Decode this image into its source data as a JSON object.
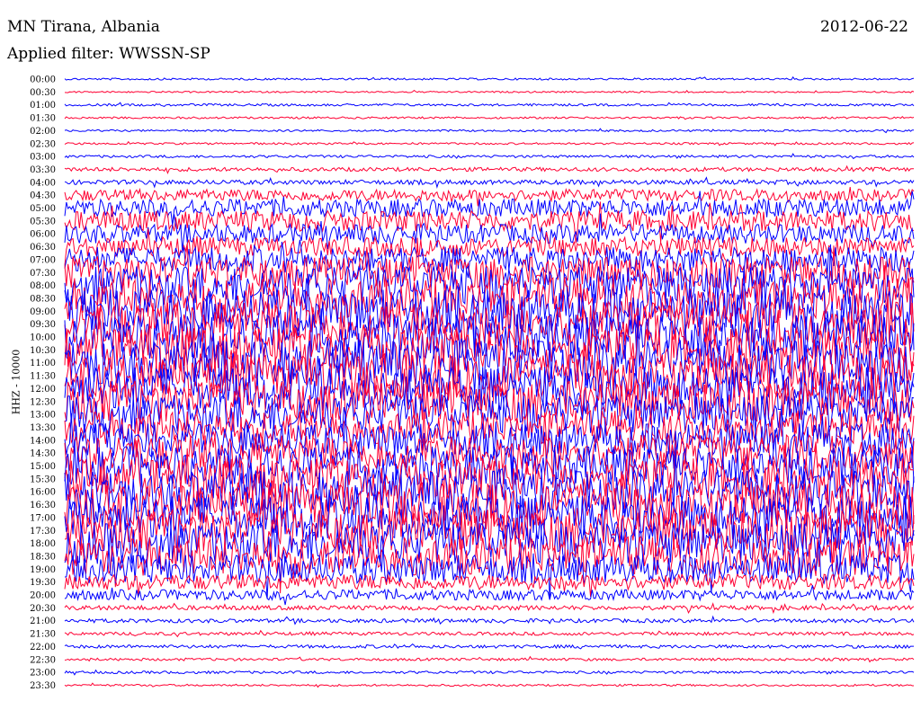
{
  "header": {
    "station": "MN Tirana, Albania",
    "date": "2012-06-22",
    "filter": "Applied filter: WWSSN-SP"
  },
  "chart_data": {
    "type": "line",
    "title": "MN Tirana, Albania",
    "ylabel": "HHZ - 10000",
    "x_range_minutes": [
      0,
      30
    ],
    "colors": [
      "#0000ff",
      "#ff0033"
    ],
    "rows": [
      {
        "label": "00:00",
        "amp": 0.15
      },
      {
        "label": "00:30",
        "amp": 0.12
      },
      {
        "label": "01:00",
        "amp": 0.18
      },
      {
        "label": "01:30",
        "amp": 0.15
      },
      {
        "label": "02:00",
        "amp": 0.15
      },
      {
        "label": "02:30",
        "amp": 0.15
      },
      {
        "label": "03:00",
        "amp": 0.2
      },
      {
        "label": "03:30",
        "amp": 0.3
      },
      {
        "label": "04:00",
        "amp": 0.35
      },
      {
        "label": "04:30",
        "amp": 0.9
      },
      {
        "label": "05:00",
        "amp": 1.4
      },
      {
        "label": "05:30",
        "amp": 1.6
      },
      {
        "label": "06:00",
        "amp": 1.5
      },
      {
        "label": "06:30",
        "amp": 1.5
      },
      {
        "label": "07:00",
        "amp": 2.0
      },
      {
        "label": "07:30",
        "amp": 2.5
      },
      {
        "label": "08:00",
        "amp": 3.0
      },
      {
        "label": "08:30",
        "amp": 3.2
      },
      {
        "label": "09:00",
        "amp": 3.4
      },
      {
        "label": "09:30",
        "amp": 3.4
      },
      {
        "label": "10:00",
        "amp": 3.5
      },
      {
        "label": "10:30",
        "amp": 3.5
      },
      {
        "label": "11:00",
        "amp": 3.5
      },
      {
        "label": "11:30",
        "amp": 3.4
      },
      {
        "label": "12:00",
        "amp": 3.4
      },
      {
        "label": "12:30",
        "amp": 3.2
      },
      {
        "label": "13:00",
        "amp": 3.0
      },
      {
        "label": "13:30",
        "amp": 2.6
      },
      {
        "label": "14:00",
        "amp": 2.6
      },
      {
        "label": "14:30",
        "amp": 2.8
      },
      {
        "label": "15:00",
        "amp": 3.0
      },
      {
        "label": "15:30",
        "amp": 3.2
      },
      {
        "label": "16:00",
        "amp": 3.3
      },
      {
        "label": "16:30",
        "amp": 3.4
      },
      {
        "label": "17:00",
        "amp": 3.4
      },
      {
        "label": "17:30",
        "amp": 3.3
      },
      {
        "label": "18:00",
        "amp": 3.2
      },
      {
        "label": "18:30",
        "amp": 3.0
      },
      {
        "label": "19:00",
        "amp": 2.2
      },
      {
        "label": "19:30",
        "amp": 1.2
      },
      {
        "label": "20:00",
        "amp": 0.8
      },
      {
        "label": "20:30",
        "amp": 0.35
      },
      {
        "label": "21:00",
        "amp": 0.3
      },
      {
        "label": "21:30",
        "amp": 0.25
      },
      {
        "label": "22:00",
        "amp": 0.25
      },
      {
        "label": "22:30",
        "amp": 0.2
      },
      {
        "label": "23:00",
        "amp": 0.2
      },
      {
        "label": "23:30",
        "amp": 0.15
      }
    ]
  }
}
